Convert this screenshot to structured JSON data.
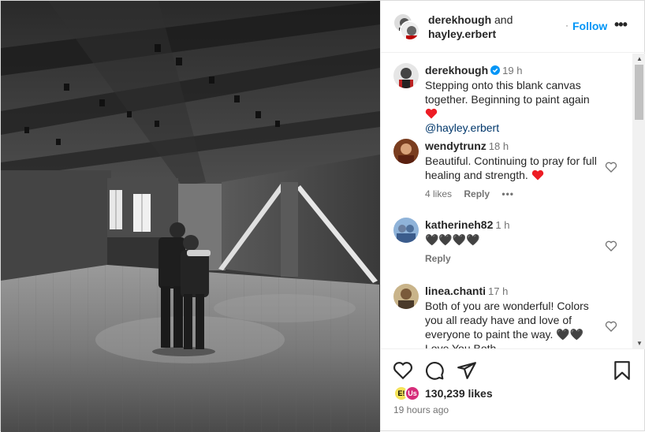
{
  "header": {
    "user1": "derekhough",
    "and_text": "and",
    "user2": "hayley.erbert",
    "separator": "·",
    "follow_label": "Follow",
    "more": "•••"
  },
  "caption": {
    "username": "derekhough",
    "verified": true,
    "time": "19 h",
    "text": "Stepping onto this blank canvas together. Beginning to paint again",
    "mention": "@hayley.erbert"
  },
  "comments": [
    {
      "username": "wendytrunz",
      "time": "18 h",
      "text": "Beautiful. Continuing to pray for full healing and strength.",
      "likes": "4 likes",
      "reply": "Reply",
      "more": "•••"
    },
    {
      "username": "katherineh82",
      "time": "1 h",
      "text": "🖤🖤🖤🖤",
      "reply": "Reply"
    },
    {
      "username": "linea.chanti",
      "time": "17 h",
      "text": "Both of you are wonderful! Colors you all ready have and love of everyone to paint the way. 🖤🖤",
      "text_cut": "Love You Both"
    }
  ],
  "likes": {
    "liker1": "E!",
    "liker2": "Us",
    "count_text": "130,239 likes"
  },
  "posted": "19 hours ago",
  "colors": {
    "accent": "#0095f6",
    "muted": "#737373",
    "heart": "#ed1c24",
    "verified": "#0095f6"
  }
}
